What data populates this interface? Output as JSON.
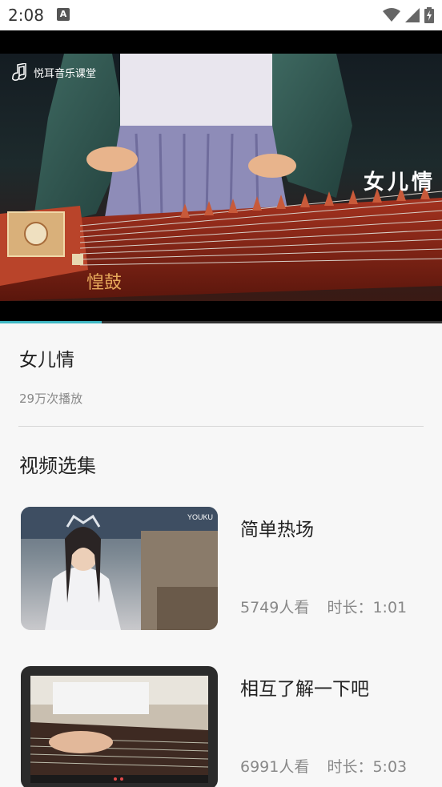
{
  "status_bar": {
    "time": "2:08",
    "notification_icon_letter": "A",
    "icons": [
      "wifi-icon",
      "signal-icon",
      "battery-charging-icon"
    ]
  },
  "video": {
    "channel_name": "悦耳音乐课堂",
    "overlay_title": "女儿情",
    "watermark_text": "惶鼓",
    "progress": 0.23,
    "accent_color": "#3fb8c4"
  },
  "info": {
    "title": "女儿情",
    "play_count": "29万次播放"
  },
  "episodes_section": {
    "title": "视频选集",
    "items": [
      {
        "name": "简单热场",
        "views": "5749人看",
        "duration_label": "时长：",
        "duration": "1:01",
        "thumb_badge": "YOUKU"
      },
      {
        "name": "相互了解一下吧",
        "views": "6991人看",
        "duration_label": "时长：",
        "duration": "5:03",
        "thumb_badge": ""
      }
    ]
  }
}
